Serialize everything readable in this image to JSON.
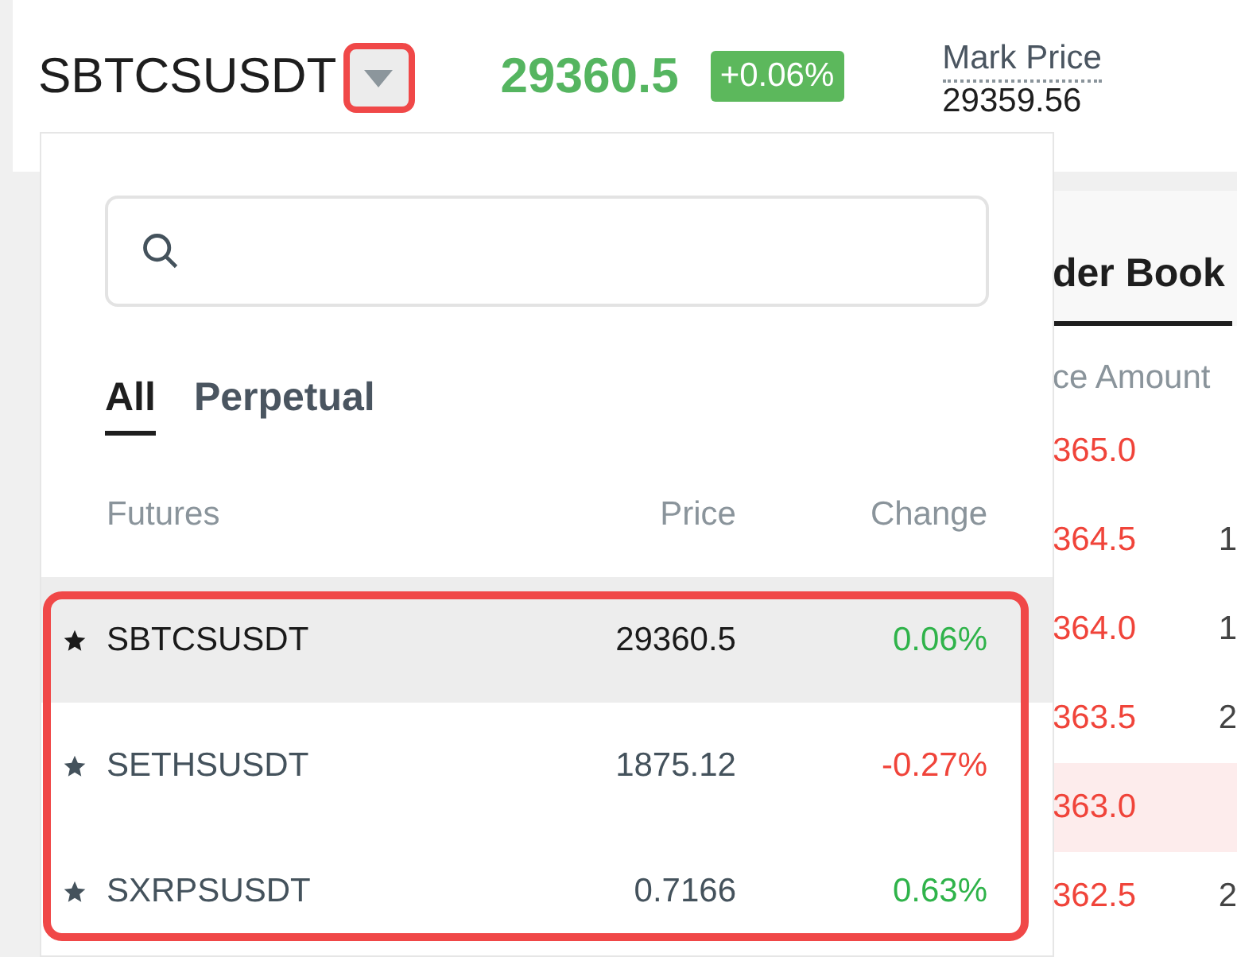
{
  "header": {
    "symbol": "SBTCSUSDT",
    "last_price": "29360.5",
    "change": "+0.06%",
    "mark_price": {
      "label": "Mark Price",
      "value": "29359.56"
    }
  },
  "symbol_dropdown": {
    "open": true,
    "tabs": [
      {
        "label": "All",
        "selected": true
      },
      {
        "label": "Perpetual",
        "selected": false
      }
    ],
    "columns": [
      "Futures",
      "Price",
      "Change"
    ],
    "rows": [
      {
        "symbol": "SBTCSUSDT",
        "price": "29360.5",
        "change": "0.06%",
        "color": "#2fb34a",
        "selected": true
      },
      {
        "symbol": "SETHSUSDT",
        "price": "1875.12",
        "change": "-0.27%",
        "color": "#f0443a",
        "selected": false
      },
      {
        "symbol": "SXRPSUSDT",
        "price": "0.7166",
        "change": "0.63%",
        "color": "#2fb34a",
        "selected": false
      }
    ]
  },
  "order_book": {
    "title": "der Book",
    "column": "ce Amount",
    "rows": [
      {
        "price": "365.0",
        "highlighted": false
      },
      {
        "price": "364.5",
        "amount": "1",
        "highlighted": false
      },
      {
        "price": "364.0",
        "amount": "1",
        "highlighted": false
      },
      {
        "price": "363.5",
        "amount": "2",
        "highlighted": false
      },
      {
        "price": "363.0",
        "highlighted": true
      },
      {
        "price": "362.5",
        "amount": "2",
        "highlighted": false
      }
    ]
  }
}
